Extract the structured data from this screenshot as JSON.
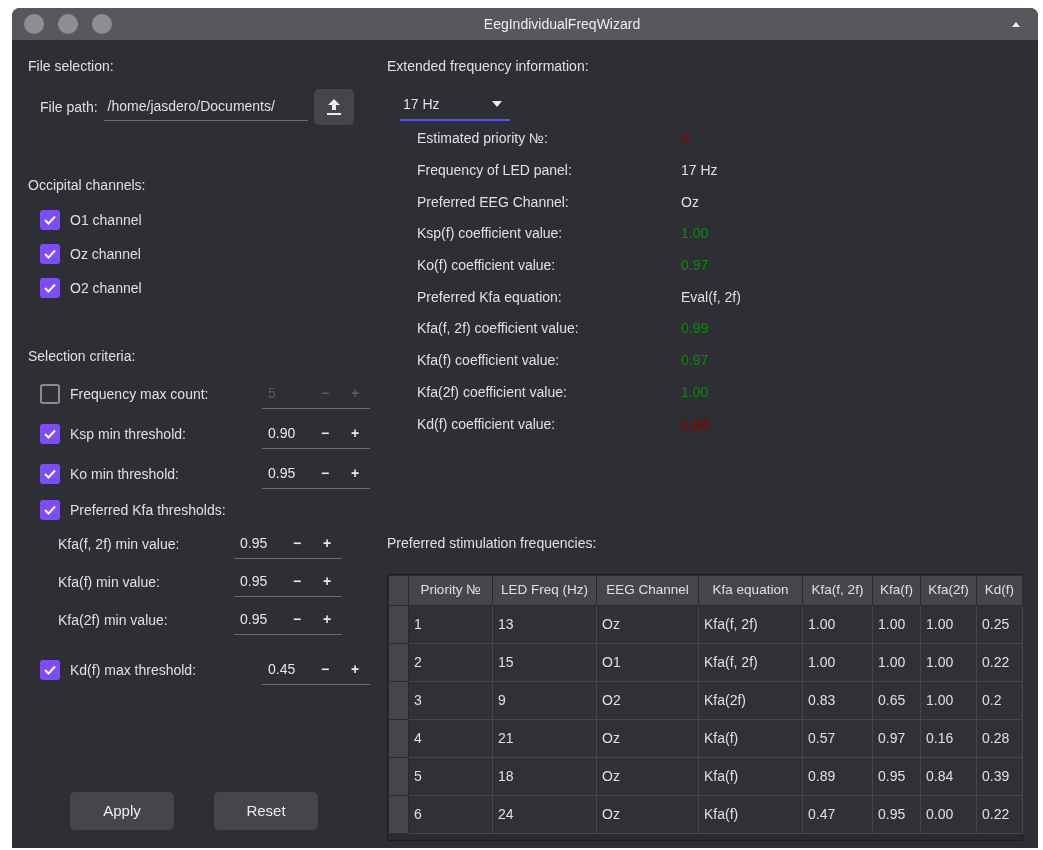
{
  "window": {
    "title": "EegIndividualFreqWizard"
  },
  "file_selection": {
    "heading": "File selection:",
    "label": "File path:",
    "value": "/home/jasdero/Documents/"
  },
  "occipital": {
    "heading": "Occipital channels:",
    "channels": [
      {
        "label": "O1 channel",
        "checked": true
      },
      {
        "label": "Oz channel",
        "checked": true
      },
      {
        "label": "O2 channel",
        "checked": true
      }
    ]
  },
  "criteria": {
    "heading": "Selection criteria:",
    "rows": [
      {
        "kind": "check",
        "label": "Frequency max count:",
        "checked": false,
        "value": "5",
        "minus": "−",
        "plus": "+"
      },
      {
        "kind": "check",
        "label": "Ksp min threshold:",
        "checked": true,
        "value": "0.90",
        "minus": "−",
        "plus": "+"
      },
      {
        "kind": "check",
        "label": "Ko min threshold:",
        "checked": true,
        "value": "0.95",
        "minus": "−",
        "plus": "+"
      },
      {
        "kind": "group",
        "label": "Preferred Kfa thresholds:",
        "checked": true
      },
      {
        "kind": "sub",
        "label": "Kfa(f, 2f) min value:",
        "value": "0.95",
        "minus": "−",
        "plus": "+"
      },
      {
        "kind": "sub",
        "label": "Kfa(f) min value:",
        "value": "0.95",
        "minus": "−",
        "plus": "+"
      },
      {
        "kind": "sub",
        "label": "Kfa(2f) min value:",
        "value": "0.95",
        "minus": "−",
        "plus": "+"
      },
      {
        "kind": "check",
        "label": "Kd(f) max threshold:",
        "checked": true,
        "value": "0.45",
        "minus": "−",
        "plus": "+"
      }
    ]
  },
  "buttons": [
    "Apply",
    "Reset"
  ],
  "extended": {
    "heading": "Extended frequency information:",
    "dropdown": "17 Hz",
    "rows": [
      {
        "label": "Estimated priority №:",
        "value": "X",
        "color": "#8b0000"
      },
      {
        "label": "Frequency of LED panel:",
        "value": "17 Hz",
        "color": "#e0e0e0"
      },
      {
        "label": "Preferred EEG Channel:",
        "value": "Oz",
        "color": "#e0e0e0"
      },
      {
        "label": "Ksp(f) coefficient value:",
        "value": "1.00",
        "color": "#0a8a0a"
      },
      {
        "label": "Ko(f) coefficient value:",
        "value": "0.97",
        "color": "#0a8a0a"
      },
      {
        "label": "Preferred Kfa equation:",
        "value": "Eval(f, 2f)",
        "color": "#e0e0e0"
      },
      {
        "label": "Kfa(f, 2f) coefficient value:",
        "value": "0.99",
        "color": "#0a8a0a"
      },
      {
        "label": "Kfa(f) coefficient value:",
        "value": "0.97",
        "color": "#0a8a0a"
      },
      {
        "label": "Kfa(2f) coefficient value:",
        "value": "1.00",
        "color": "#0a8a0a"
      },
      {
        "label": "Kd(f) coefficient value:",
        "value": "0.84",
        "color": "#8b0000"
      }
    ]
  },
  "table": {
    "heading": "Preferred stimulation frequencies:",
    "columns": [
      "Priority №",
      "LED Freq (Hz)",
      "EEG Channel",
      "Kfa equation",
      "Kfa(f, 2f)",
      "Kfa(f)",
      "Kfa(2f)",
      "Kd(f)"
    ],
    "rows": [
      [
        "1",
        "13",
        "Oz",
        "Kfa(f, 2f)",
        "1.00",
        "1.00",
        "1.00",
        "0.25"
      ],
      [
        "2",
        "15",
        "O1",
        "Kfa(f, 2f)",
        "1.00",
        "1.00",
        "1.00",
        "0.22"
      ],
      [
        "3",
        "9",
        "O2",
        "Kfa(2f)",
        "0.83",
        "0.65",
        "1.00",
        "0.2"
      ],
      [
        "4",
        "21",
        "Oz",
        "Kfa(f)",
        "0.57",
        "0.97",
        "0.16",
        "0.28"
      ],
      [
        "5",
        "18",
        "Oz",
        "Kfa(f)",
        "0.89",
        "0.95",
        "0.84",
        "0.39"
      ],
      [
        "6",
        "24",
        "Oz",
        "Kfa(f)",
        "0.47",
        "0.95",
        "0.00",
        "0.22"
      ]
    ]
  }
}
